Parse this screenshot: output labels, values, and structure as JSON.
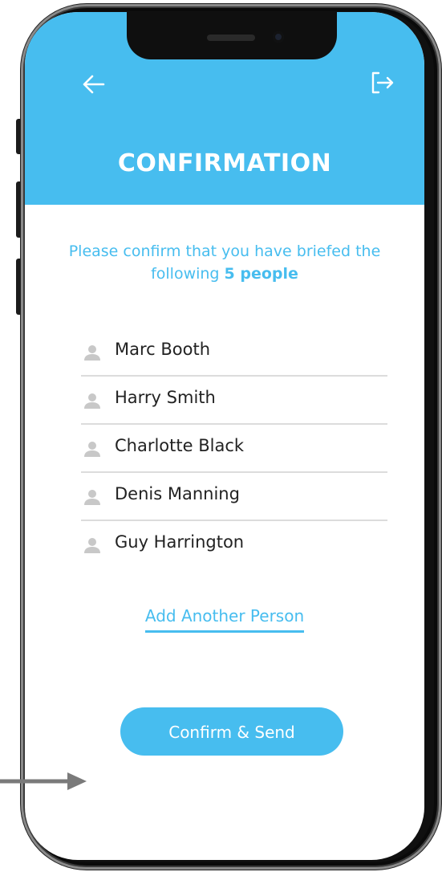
{
  "header": {
    "title": "CONFIRMATION",
    "back_icon": "arrow-left-icon",
    "logout_icon": "logout-icon",
    "background_color": "#47bdef"
  },
  "instruction": {
    "line_prefix": "Please confirm that you have briefed the following ",
    "count_text": "5 people"
  },
  "people": [
    {
      "name": "Marc Booth",
      "icon": "person-icon"
    },
    {
      "name": "Harry Smith",
      "icon": "person-icon"
    },
    {
      "name": "Charlotte Black",
      "icon": "person-icon"
    },
    {
      "name": "Denis Manning",
      "icon": "person-icon"
    },
    {
      "name": "Guy Harrington",
      "icon": "person-icon"
    }
  ],
  "actions": {
    "add_person_label": "Add Another Person",
    "confirm_label": "Confirm & Send"
  },
  "colors": {
    "accent": "#47bdef",
    "text": "#222222",
    "divider": "#dcdcdc",
    "icon_gray": "#c8c8c8"
  }
}
